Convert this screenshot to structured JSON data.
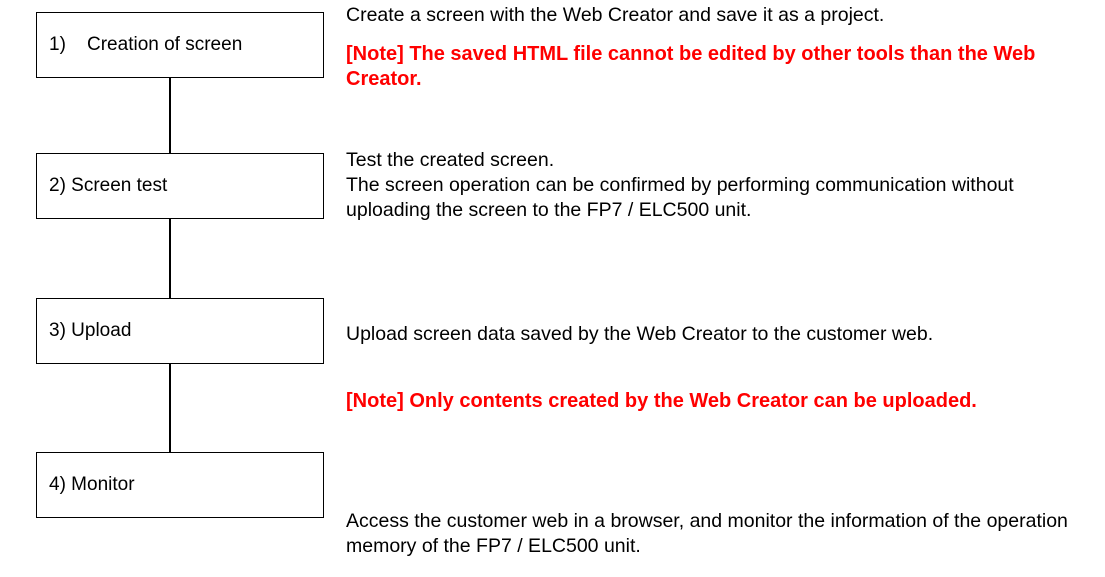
{
  "steps": [
    {
      "label": "1)    Creation of screen"
    },
    {
      "label": "2) Screen test"
    },
    {
      "label": "3) Upload"
    },
    {
      "label": "4) Monitor"
    }
  ],
  "descriptions": {
    "step1": {
      "text": "Create a screen with the Web Creator and save it as a project.",
      "note": "[Note] The saved HTML file cannot be edited by other tools than the Web Creator."
    },
    "step2": {
      "text": "Test the created screen.\nThe screen operation can be confirmed by performing communication without uploading the screen to the FP7 / ELC500 unit."
    },
    "step3": {
      "text": "Upload screen data saved by the Web Creator to the customer web.",
      "note": "[Note] Only contents created by the Web Creator can be uploaded."
    },
    "step4": {
      "text": "Access the customer web in a browser, and monitor the information of the operation memory of the FP7 / ELC500 unit."
    }
  },
  "colors": {
    "note": "#ff0000",
    "border": "#000000"
  }
}
